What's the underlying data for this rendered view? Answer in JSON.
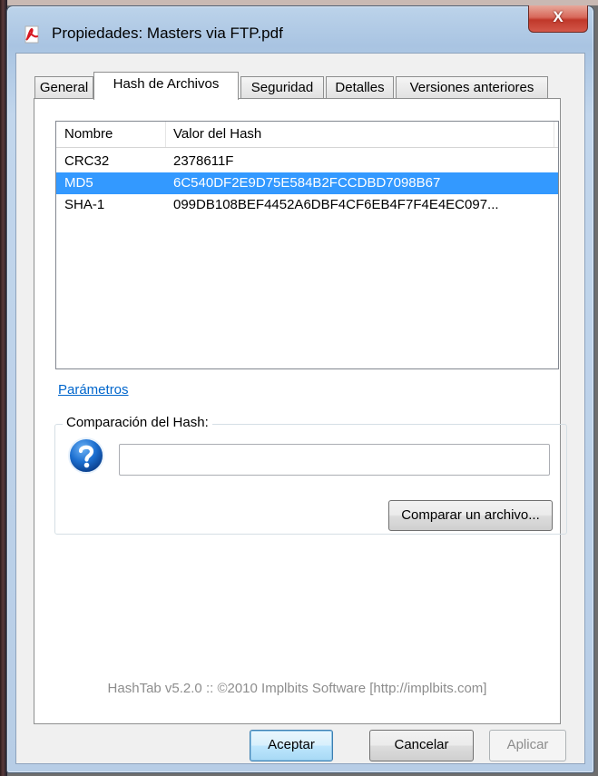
{
  "window": {
    "title": "Propiedades: Masters via FTP.pdf",
    "close_label": "X"
  },
  "tabs": [
    {
      "label": "General",
      "active": false
    },
    {
      "label": "Hash de Archivos",
      "active": true
    },
    {
      "label": "Seguridad",
      "active": false
    },
    {
      "label": "Detalles",
      "active": false
    },
    {
      "label": "Versiones anteriores",
      "active": false
    }
  ],
  "hash_list": {
    "columns": [
      "Nombre",
      "Valor del Hash"
    ],
    "rows": [
      {
        "name": "CRC32",
        "value": "2378611F",
        "selected": false
      },
      {
        "name": "MD5",
        "value": "6C540DF2E9D75E584B2FCCDBD7098B67",
        "selected": true
      },
      {
        "name": "SHA-1",
        "value": "099DB108BEF4452A6DBF4CF6EB4F7F4E4EC097...",
        "selected": false
      }
    ]
  },
  "settings_link": "Parámetros",
  "compare": {
    "group_label": "Comparación del Hash:",
    "input_value": "",
    "compare_button": "Comparar un archivo..."
  },
  "credit": "HashTab v5.2.0 :: ©2010 Implbits Software [http://implbits.com]",
  "buttons": {
    "ok": "Aceptar",
    "cancel": "Cancelar",
    "apply": "Aplicar"
  },
  "colors": {
    "selection": "#3399ff",
    "link": "#0066cc",
    "close_button": "#c0382a"
  },
  "icons": {
    "title": "pdf-document-icon",
    "compare_status": "question-mark-icon"
  }
}
